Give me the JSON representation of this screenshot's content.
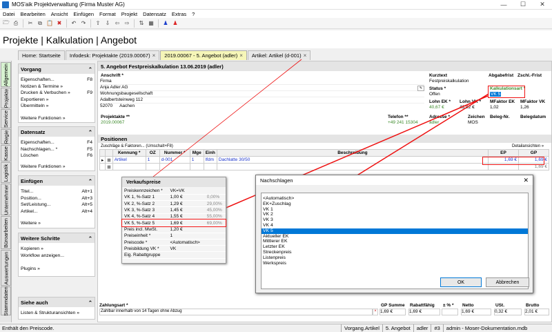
{
  "window": {
    "title": "MOS'aik Projektverwaltung (Firma Muster AG)"
  },
  "menu": [
    "Datei",
    "Bearbeiten",
    "Ansicht",
    "Einfügen",
    "Format",
    "Projekt",
    "Datensatz",
    "Extras",
    "?"
  ],
  "page_title": "Projekte | Kalkulation | Angebot",
  "tabs": [
    {
      "label": "Home: Startseite"
    },
    {
      "label": "Infodesk: Projektakte (2019.00067)"
    },
    {
      "label": "2019.00067 - 5. Angebot (adler)"
    },
    {
      "label": "Artikel: Artikel (d-001)"
    }
  ],
  "vtabs": [
    "Allgemein",
    "Projekte",
    "Service",
    "Regie",
    "Kasse",
    "Logistik",
    "Unternehmer",
    "Büroarbeiten",
    "Auswertungen",
    "Stammdaten"
  ],
  "sidebar": {
    "vorgang": {
      "title": "Vorgang",
      "items": [
        {
          "label": "Eigenschaften...",
          "key": "F8"
        },
        {
          "label": "Notizen & Termine »",
          "key": ""
        },
        {
          "label": "Drucken & Verbuchen »",
          "key": "F9"
        },
        {
          "label": "Exportieren »",
          "key": ""
        },
        {
          "label": "Übermitteln »",
          "key": ""
        }
      ],
      "more": "Weitere Funktionen »"
    },
    "datensatz": {
      "title": "Datensatz",
      "items": [
        {
          "label": "Eigenschaften...",
          "key": "F4"
        },
        {
          "label": "Nachschlagen... *",
          "key": "F5"
        },
        {
          "label": "Löschen",
          "key": "F6"
        }
      ],
      "more": "Weitere Funktionen »"
    },
    "einfuegen": {
      "title": "Einfügen",
      "items": [
        {
          "label": "Titel...",
          "key": "Alt+1"
        },
        {
          "label": "Position...",
          "key": "Alt+3"
        },
        {
          "label": "Set/Leistung...",
          "key": "Alt+5"
        },
        {
          "label": "Artikel...",
          "key": "Alt+4"
        }
      ],
      "more": "Weitere »"
    },
    "schritte": {
      "title": "Weitere Schritte",
      "items": [
        {
          "label": "Kopieren »",
          "key": ""
        },
        {
          "label": "Workflow anzeigen...",
          "key": ""
        }
      ],
      "more": "Plugins »"
    },
    "siehe": {
      "title": "Siehe auch",
      "items": [
        {
          "label": "Listen & Strukturansichten »",
          "key": ""
        }
      ]
    }
  },
  "header": {
    "title": "5. Angebot Festpreiskalkulation 13.06.2019 (adler)",
    "anschrift_label": "Anschrift *",
    "anschrift": [
      "Firma",
      "Anja Adler AG",
      "Wohnungsbaugesellschaft",
      "Adalbertsteinweg 112"
    ],
    "plz": "52070",
    "ort": "Aachen",
    "kurztext_label": "Kurztext",
    "kurztext": "Festpreiskalkulation",
    "abgabefrist_label": "Abgabefrist",
    "zschl_label": "Zschl.-Frist",
    "status_label": "Status *",
    "status": "Offen",
    "kalkart_label": "Kalkulationsart *",
    "kalkart": "VK 5",
    "lohnek_label": "Lohn EK *",
    "lohnek": "40,67 €",
    "lohnvk_label": "Lohn VK *",
    "lohnvk": "43,92 €",
    "mfek_label": "MFaktor EK",
    "mfek": "1,02",
    "mfvk_label": "MFaktor VK",
    "mfvk": "1,26",
    "projektakte_label": "Projektakte **",
    "projektakte": "2019.00067",
    "telefon_label": "Telefon **",
    "telefon": "+49 241 15304",
    "adresse_label": "Adresse *",
    "adresse": "adler",
    "zeichen_label": "Zeichen",
    "zeichen": "MOS",
    "belegnr_label": "Beleg-Nr.",
    "belegdatum_label": "Belegdatum"
  },
  "positions": {
    "title": "Positionen",
    "subtitle": "Zuschläge & Faktoren... (Umschalt+F8)",
    "details": "Detailansichten »",
    "columns": [
      "Kennung *",
      "OZ",
      "Nummer *",
      "Mge",
      "Einh",
      "Beschreibung",
      "EP",
      "GP"
    ],
    "rows": [
      {
        "kennung": "Artikel",
        "oz": "1",
        "nummer": "d-001",
        "mge": "1",
        "einh": "lfdm",
        "beschreibung": "Dachlatte 30/50",
        "ep": "1,69 €",
        "gp": "1,69 €"
      }
    ],
    "total": "1,69 €"
  },
  "verkaufspreise": {
    "title": "Verkaufspreise",
    "rows": [
      {
        "label": "Preiskennzeichen *",
        "value": "VK=VK",
        "pct": ""
      },
      {
        "label": "VK 1, %-Satz 1",
        "value": "1,00 €",
        "pct": "0,00%"
      },
      {
        "label": "VK 2, %-Satz 2",
        "value": "1,29 €",
        "pct": "29,00%"
      },
      {
        "label": "VK 3, %-Satz 3",
        "value": "1,45 €",
        "pct": "45,00%"
      },
      {
        "label": "VK 4, %-Satz 4",
        "value": "1,55 €",
        "pct": "55,00%"
      },
      {
        "label": "VK 5, %-Satz 5",
        "value": "1,69 €",
        "pct": "69,00%"
      },
      {
        "label": "Preis incl. MwSt.",
        "value": "1,20 €",
        "pct": ""
      },
      {
        "label": "Preiseinheit *",
        "value": "1",
        "pct": ""
      },
      {
        "label": "Preiscode *",
        "value": "<Automatisch>",
        "pct": ""
      },
      {
        "label": "Preisbildung VK *",
        "value": "VK",
        "pct": ""
      },
      {
        "label": "Eig. Rabattgruppe",
        "value": "",
        "pct": ""
      }
    ]
  },
  "nachschlagen": {
    "title": "Nachschlagen",
    "items": [
      "<Automatisch>",
      "EK+Zuschlag",
      "VK 1",
      "VK 2",
      "VK 3",
      "VK 4",
      "VK 5",
      "Aktueller EK",
      "Mittlerer EK",
      "Letzter EK",
      "Streckenpreis",
      "Listenpreis",
      "Werkspreis"
    ],
    "selected": 6,
    "ok": "OK",
    "cancel": "Abbrechen"
  },
  "footer": {
    "zahlungsart_label": "Zahlungsart *",
    "zahlungsart": "Zahlbar innerhalb von 14 Tagen ohne Abzug",
    "gpsumme_label": "GP Summe",
    "gpsumme": "1,69 €",
    "rabatt_label": "Rabattfähig",
    "rabatt": "1,69 €",
    "pct_label": "± % *",
    "pct": "",
    "netto_label": "Netto",
    "netto": "1,69 €",
    "ust_label": "USt.",
    "ust": "0,32 €",
    "brutto_label": "Brutto",
    "brutto": "2,01 €"
  },
  "statusbar": {
    "message": "Enthält den Preiscode.",
    "c1": "Vorgang.Artikel",
    "c2": "5. Angebot",
    "c3": "adler",
    "c4": "#3",
    "c5": "admin - Moser-Dokumentation.mdb"
  }
}
